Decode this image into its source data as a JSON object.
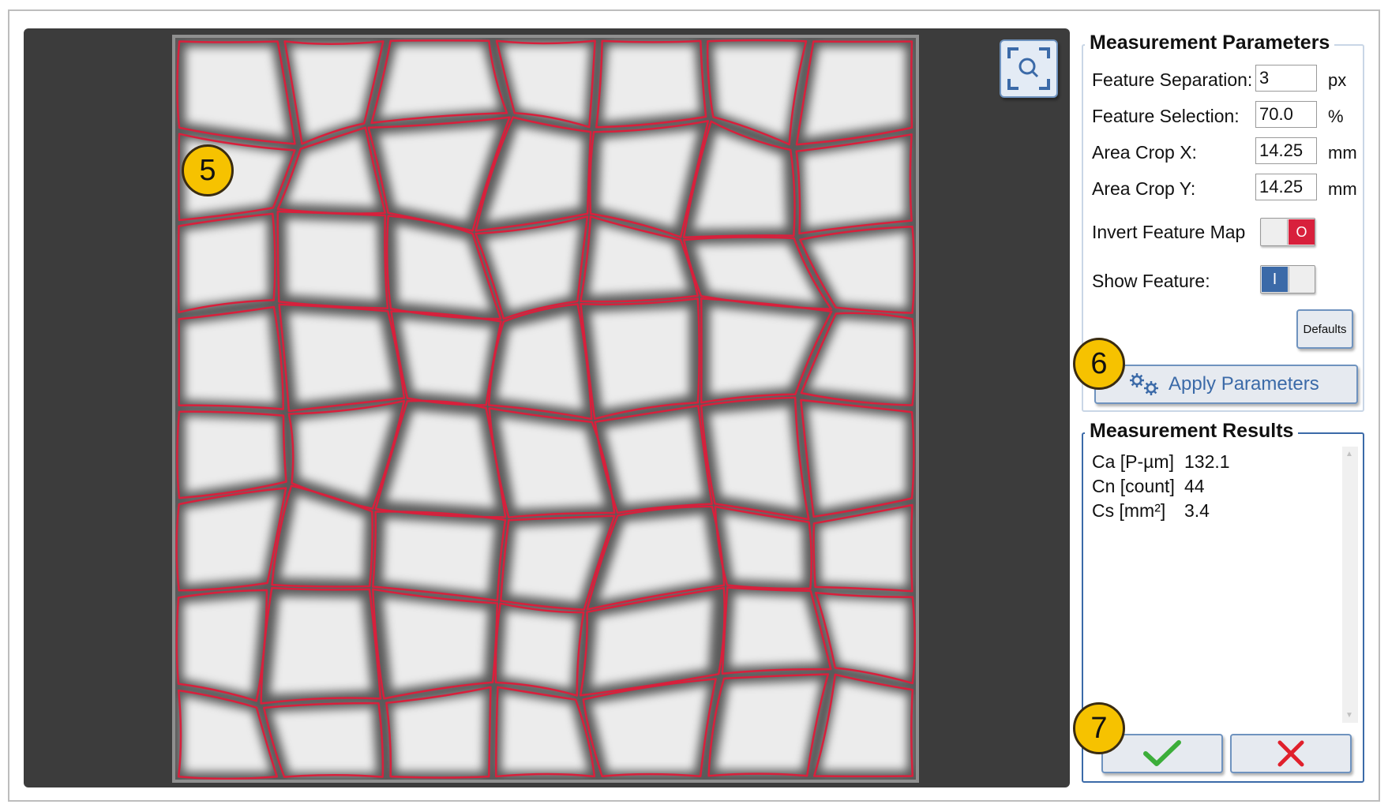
{
  "viewer": {
    "zoom_icon": "zoom-fit-icon",
    "image_description_icon": "segmented-microstructure-image"
  },
  "callouts": {
    "c5": "5",
    "c6": "6",
    "c7": "7"
  },
  "params": {
    "title": "Measurement Parameters",
    "feature_separation_label": "Feature Separation:",
    "feature_separation_value": "3",
    "feature_separation_unit": "px",
    "feature_selection_label": "Feature Selection:",
    "feature_selection_value": "70.0",
    "feature_selection_unit": "%",
    "area_crop_x_label": "Area Crop X:",
    "area_crop_x_value": "14.25",
    "area_crop_x_unit": "mm",
    "area_crop_y_label": "Area Crop Y:",
    "area_crop_y_value": "14.25",
    "area_crop_y_unit": "mm",
    "invert_label": "Invert Feature Map",
    "invert_state": "O",
    "show_feature_label": "Show Feature:",
    "show_feature_state": "I",
    "defaults_label": "Defaults",
    "apply_label": "Apply Parameters"
  },
  "results": {
    "title": "Measurement Results",
    "rows": [
      {
        "label": "Ca [P-µm]",
        "value": "132.1"
      },
      {
        "label": "Cn [count]",
        "value": "44"
      },
      {
        "label": "Cs [mm²]",
        "value": "3.4"
      }
    ]
  },
  "colors": {
    "boundary": "#d8203c",
    "accept": "#3cae3a",
    "cancel": "#e0202c",
    "toggle_on": "#3b6aa8"
  }
}
